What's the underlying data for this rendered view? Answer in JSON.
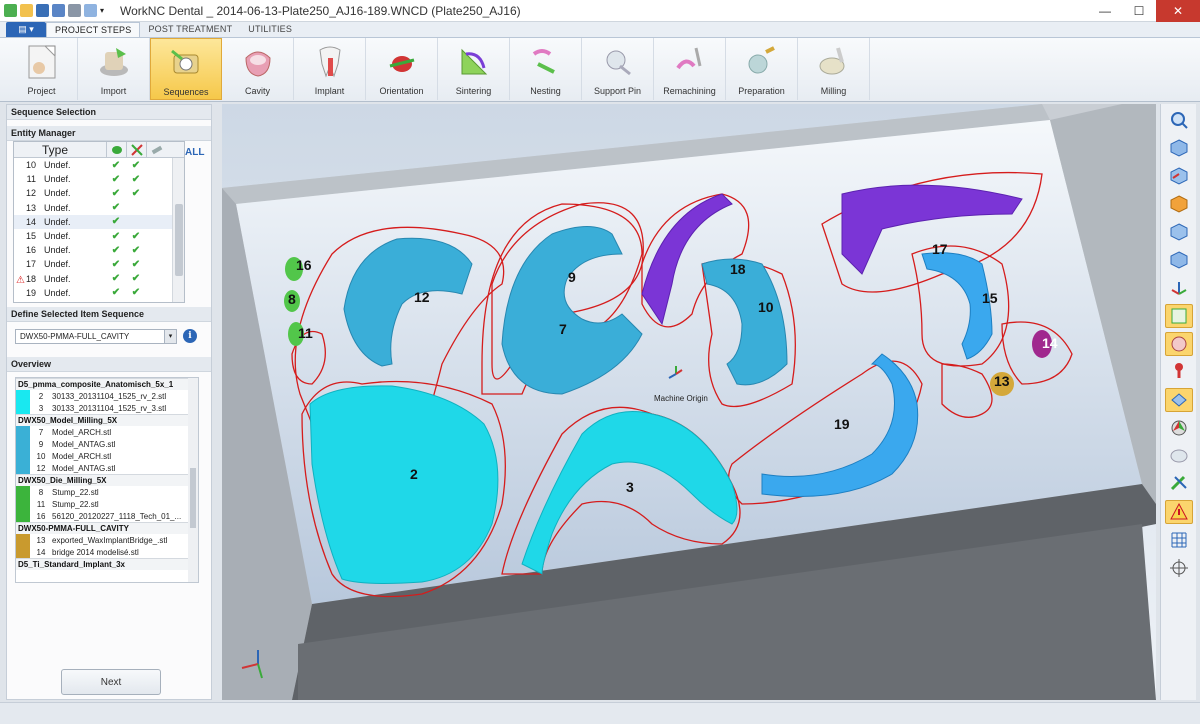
{
  "window": {
    "title": "WorkNC Dental _ 2014-06-13-Plate250_AJ16-189.WNCD (Plate250_AJ16)",
    "controls": [
      "minimize-icon",
      "maximize-icon",
      "close-icon"
    ]
  },
  "tabs": [
    "PROJECT STEPS",
    "POST TREATMENT",
    "UTILITIES"
  ],
  "ribbon": [
    {
      "label": "Project",
      "icon": "project-icon"
    },
    {
      "label": "Import",
      "icon": "import-icon"
    },
    {
      "label": "Sequences",
      "icon": "sequences-icon",
      "active": true
    },
    {
      "label": "Cavity",
      "icon": "cavity-icon"
    },
    {
      "label": "Implant",
      "icon": "implant-icon"
    },
    {
      "label": "Orientation",
      "icon": "orientation-icon"
    },
    {
      "label": "Sintering",
      "icon": "sintering-icon"
    },
    {
      "label": "Nesting",
      "icon": "nesting-icon"
    },
    {
      "label": "Support Pin",
      "icon": "support-pin-icon"
    },
    {
      "label": "Remachining",
      "icon": "remachining-icon"
    },
    {
      "label": "Preparation",
      "icon": "preparation-icon"
    },
    {
      "label": "Milling",
      "icon": "milling-icon"
    }
  ],
  "left": {
    "sequence_title": "Sequence Selection",
    "entity_title": "Entity Manager",
    "type_header": "Type",
    "all_label": "ALL",
    "rows": [
      {
        "n": "10",
        "t": "Undef.",
        "a": "✔",
        "b": "✔"
      },
      {
        "n": "11",
        "t": "Undef.",
        "a": "✔",
        "b": "✔"
      },
      {
        "n": "12",
        "t": "Undef.",
        "a": "✔",
        "b": "✔"
      },
      {
        "n": "13",
        "t": "Undef.",
        "a": "✔",
        "b": ""
      },
      {
        "n": "14",
        "t": "Undef.",
        "a": "✔",
        "b": ""
      },
      {
        "n": "15",
        "t": "Undef.",
        "a": "✔",
        "b": "✔"
      },
      {
        "n": "16",
        "t": "Undef.",
        "a": "✔",
        "b": "✔"
      },
      {
        "n": "17",
        "t": "Undef.",
        "a": "✔",
        "b": "✔"
      },
      {
        "n": "18",
        "t": "Undef.",
        "a": "✔",
        "b": "✔",
        "warn": true
      },
      {
        "n": "19",
        "t": "Undef.",
        "a": "✔",
        "b": "✔"
      }
    ],
    "define_title": "Define Selected Item Sequence",
    "dropdown_value": "DWX50-PMMA-FULL_CAVITY",
    "overview_title": "Overview",
    "overview": [
      {
        "group": "D5_pmma_composite_Anatomisch_5x_1",
        "items": [
          {
            "n": "2",
            "f": "30133_20131104_1525_rv_2.stl",
            "c": "#19e8f0"
          },
          {
            "n": "3",
            "f": "30133_20131104_1525_rv_3.stl",
            "c": "#19e8f0"
          }
        ]
      },
      {
        "group": "DWX50_Model_Milling_5X",
        "items": [
          {
            "n": "7",
            "f": "Model_ARCH.stl",
            "c": "#3ab0d6"
          },
          {
            "n": "9",
            "f": "Model_ANTAG.stl",
            "c": "#3ab0d6"
          },
          {
            "n": "10",
            "f": "Model_ARCH.stl",
            "c": "#3ab0d6"
          },
          {
            "n": "12",
            "f": "Model_ANTAG.stl",
            "c": "#3ab0d6"
          }
        ]
      },
      {
        "group": "DWX50_Die_Milling_5X",
        "items": [
          {
            "n": "8",
            "f": "Stump_22.stl",
            "c": "#3cb43c"
          },
          {
            "n": "11",
            "f": "Stump_22.stl",
            "c": "#3cb43c"
          },
          {
            "n": "16",
            "f": "56120_20120227_1118_Tech_01_...",
            "c": "#3cb43c"
          }
        ]
      },
      {
        "group": "DWX50-PMMA-FULL_CAVITY",
        "items": [
          {
            "n": "13",
            "f": "exported_WaxImplantBridge_.stl",
            "c": "#c99a2e"
          },
          {
            "n": "14",
            "f": "bridge 2014 modelisé.stl",
            "c": "#c99a2e"
          }
        ]
      },
      {
        "group": "D5_Ti_Standard_Implant_3x",
        "items": []
      }
    ],
    "next_label": "Next"
  },
  "viewport": {
    "origin_label": "Machine Origin",
    "labels": [
      "2",
      "3",
      "7",
      "8",
      "9",
      "10",
      "11",
      "12",
      "13",
      "14",
      "15",
      "16",
      "17",
      "18",
      "19"
    ]
  },
  "colors": {
    "cyan": "#1fd8e8",
    "blue_model": "#3aaed8",
    "purple": "#7b35d6",
    "green": "#52c64a",
    "gold": "#d4a83a",
    "magenta": "#a0288e",
    "outline": "#d51c1c"
  }
}
